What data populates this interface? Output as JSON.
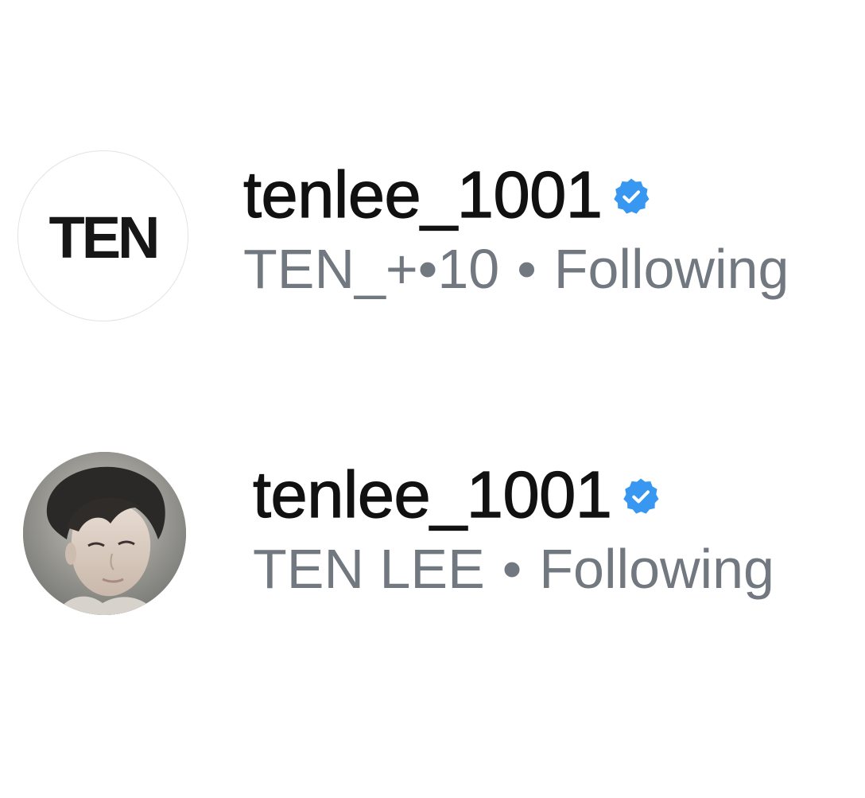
{
  "entries": [
    {
      "avatar_text": "TEN",
      "username": "tenlee_1001",
      "display_name": "TEN_+•10",
      "separator": "•",
      "status": "Following",
      "verified_icon": "verified-badge-icon"
    },
    {
      "avatar_text": "",
      "username": "tenlee_1001",
      "display_name": "TEN LEE",
      "separator": "•",
      "status": "Following",
      "verified_icon": "verified-badge-icon"
    }
  ],
  "colors": {
    "username": "#111111",
    "secondary": "#727880",
    "verified": "#3897f0",
    "avatar_border": "#e3e3e3"
  }
}
